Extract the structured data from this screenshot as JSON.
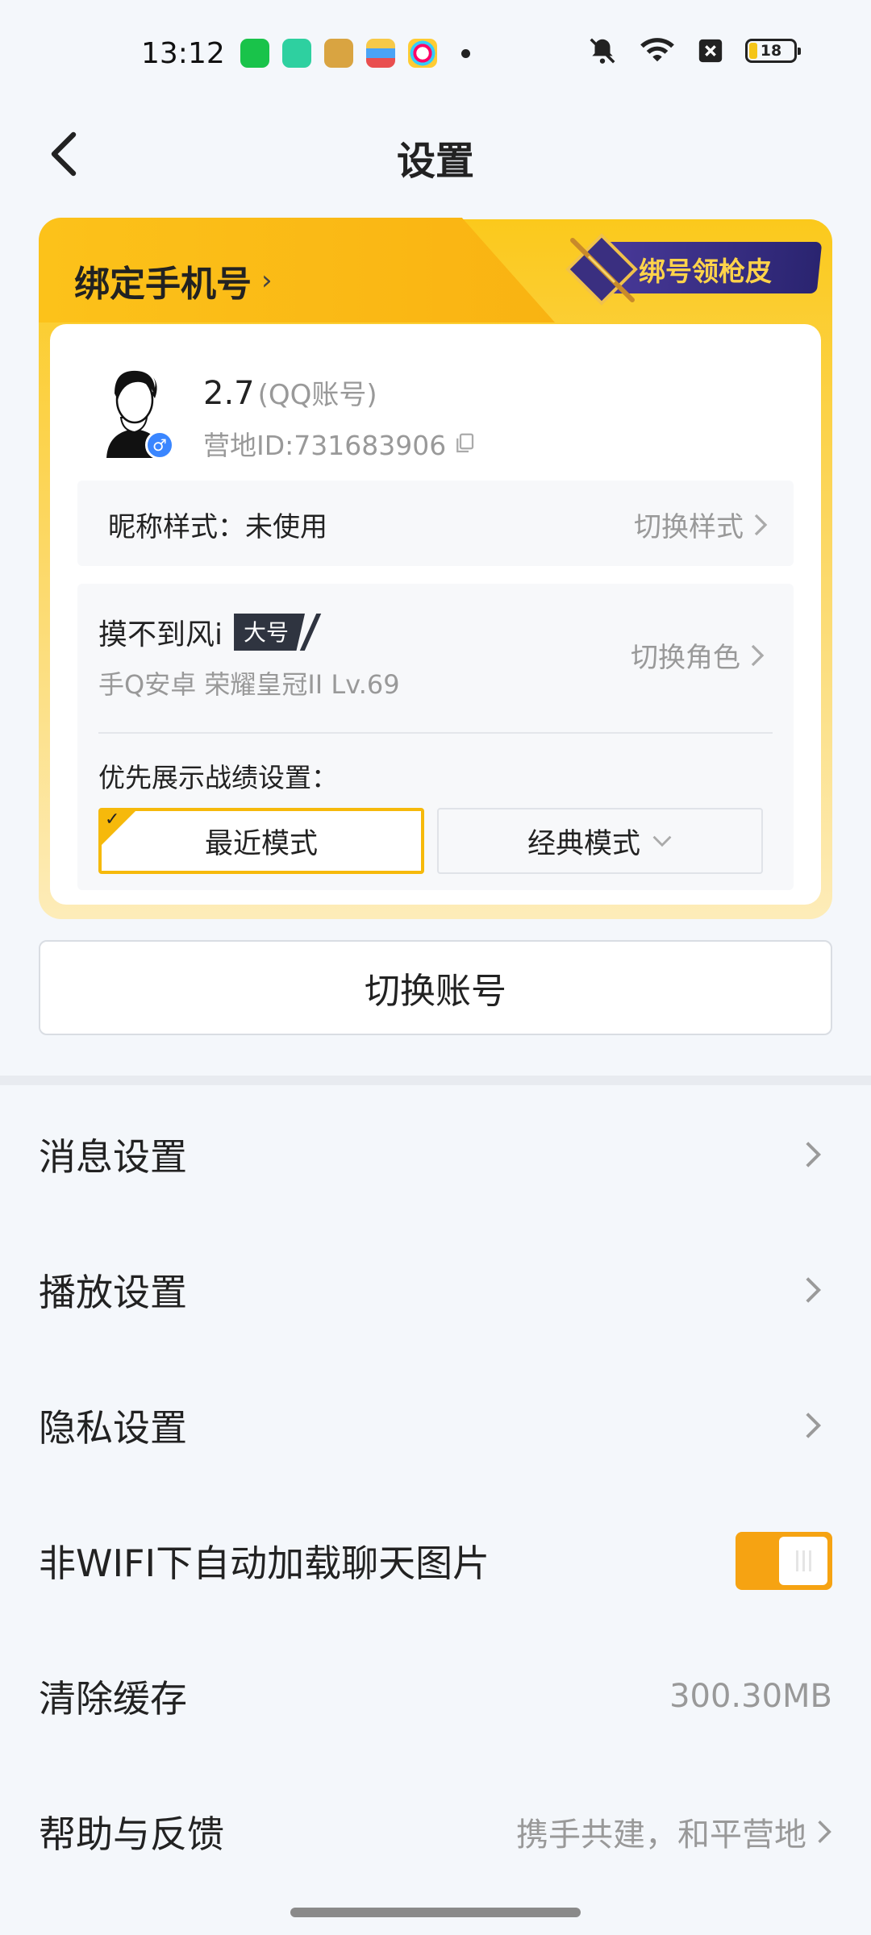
{
  "status_bar": {
    "time": "13:12",
    "battery": "18",
    "icons": [
      "app-green-icon",
      "battery-saver-icon",
      "peace-elite-app-icon",
      "wallet-icon",
      "photos-app-icon",
      "bell-off-icon",
      "wifi-icon",
      "sim-off-icon"
    ]
  },
  "header": {
    "title": "设置",
    "back_icon": "back-arrow-icon"
  },
  "account_card": {
    "bind_phone": "绑定手机号",
    "promo": "绑号领枪皮",
    "name": "2.7",
    "account_type": "(QQ账号)",
    "camp_id": "营地ID:731683906",
    "nickname_style_label": "昵称样式：未使用",
    "nickname_style_action": "切换样式",
    "role_name": "摸不到风i",
    "role_tag": "大号",
    "role_info": "手Q安卓  荣耀皇冠II  Lv.69",
    "role_action": "切换角色",
    "pref_label": "优先展示战绩设置：",
    "mode_recent": "最近模式",
    "mode_classic": "经典模式"
  },
  "switch_account": "切换账号",
  "menu": {
    "message": "消息设置",
    "playback": "播放设置",
    "privacy": "隐私设置",
    "autoload": "非WIFI下自动加载聊天图片",
    "autoload_on": true,
    "clear_cache": "清除缓存",
    "cache_size": "300.30MB",
    "help": "帮助与反馈",
    "help_value": "携手共建，和平营地"
  },
  "colors": {
    "accent": "#f6a312",
    "card_gold": "#fbc91c",
    "background": "#f4f7fb"
  }
}
